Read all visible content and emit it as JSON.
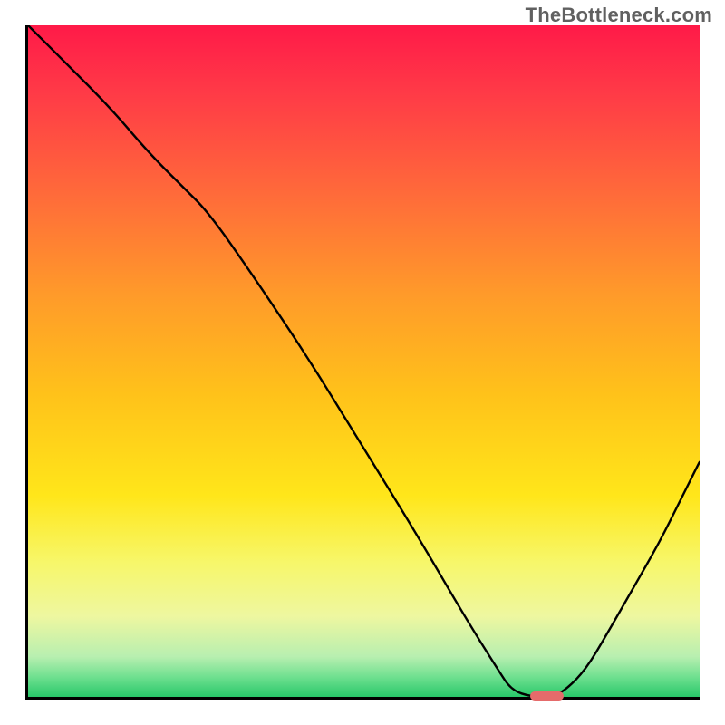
{
  "watermark": "TheBottleneck.com",
  "colors": {
    "frame": "#000000",
    "curve": "#000000",
    "marker": "#e56b6b",
    "gradient_stops": [
      {
        "offset": 0.0,
        "color": "#ff1a48"
      },
      {
        "offset": 0.1,
        "color": "#ff3a47"
      },
      {
        "offset": 0.25,
        "color": "#ff6a3a"
      },
      {
        "offset": 0.4,
        "color": "#ff9a2a"
      },
      {
        "offset": 0.55,
        "color": "#ffc21a"
      },
      {
        "offset": 0.7,
        "color": "#ffe61a"
      },
      {
        "offset": 0.8,
        "color": "#f7f76a"
      },
      {
        "offset": 0.88,
        "color": "#eef7a0"
      },
      {
        "offset": 0.94,
        "color": "#b8efb0"
      },
      {
        "offset": 0.97,
        "color": "#70e090"
      },
      {
        "offset": 1.0,
        "color": "#28c86a"
      }
    ]
  },
  "chart_data": {
    "type": "line",
    "title": "",
    "xlabel": "",
    "ylabel": "",
    "xlim": [
      0,
      1
    ],
    "ylim": [
      0,
      1
    ],
    "x": [
      0.0,
      0.06,
      0.12,
      0.18,
      0.23,
      0.27,
      0.34,
      0.42,
      0.5,
      0.58,
      0.65,
      0.7,
      0.72,
      0.75,
      0.78,
      0.8,
      0.83,
      0.86,
      0.9,
      0.94,
      0.97,
      1.0
    ],
    "values": [
      1.0,
      0.94,
      0.88,
      0.81,
      0.76,
      0.72,
      0.62,
      0.5,
      0.37,
      0.24,
      0.12,
      0.04,
      0.01,
      0.0,
      0.0,
      0.01,
      0.04,
      0.09,
      0.16,
      0.23,
      0.29,
      0.35
    ],
    "marker": {
      "x_start": 0.745,
      "x_end": 0.795,
      "y": 0.005
    }
  }
}
